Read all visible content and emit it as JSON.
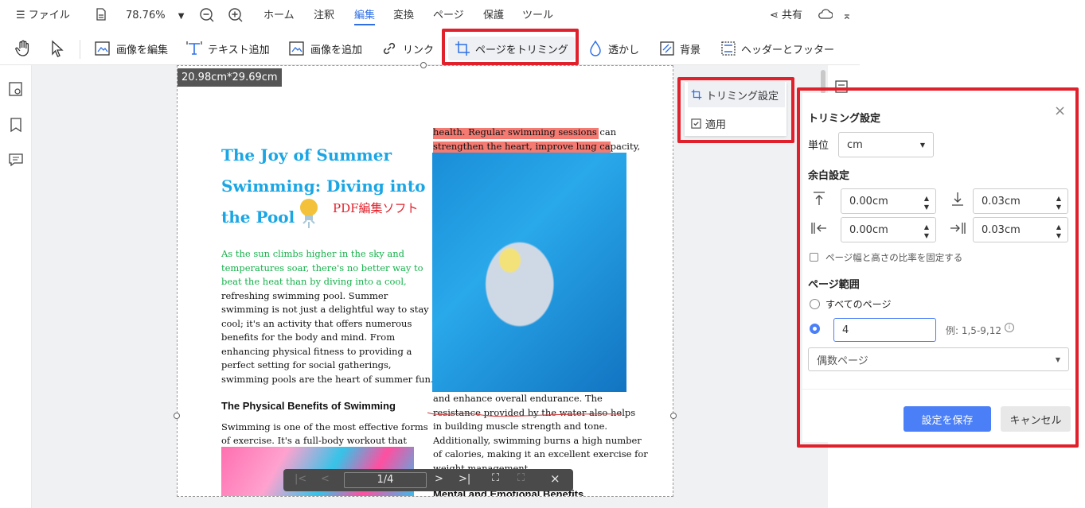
{
  "menubar": {
    "file_label": "ファイル",
    "zoom": "78.76%",
    "tabs": [
      "ホーム",
      "注釈",
      "編集",
      "変換",
      "ページ",
      "保護",
      "ツール"
    ],
    "active_tab": "編集",
    "share_label": "共有"
  },
  "toolbar": {
    "edit_image": "画像を編集",
    "add_text": "テキスト追加",
    "add_image": "画像を追加",
    "link": "リンク",
    "crop_page": "ページをトリミング",
    "watermark": "透かし",
    "background": "背景",
    "header_footer": "ヘッダーとフッター"
  },
  "document": {
    "dimension": "20.98cm*29.69cm",
    "title_lines": [
      "The Joy of Summer",
      "Swimming: Diving into",
      "the Pool"
    ],
    "annotation": "PDF編集ソフト",
    "intro_green": [
      "As the sun climbs higher in the sky and",
      "temperatures soar, there's no better way to",
      "beat the heat than by diving into a cool,"
    ],
    "intro_black": [
      "refreshing swimming pool. Summer",
      "swimming is not just a delightful way to stay",
      "cool; it's an activity that offers numerous",
      "benefits for the body and mind. From",
      "enhancing physical fitness to providing a",
      "perfect setting for social gatherings,",
      "swimming pools are the heart of summer fun."
    ],
    "subheading": "The Physical Benefits of Swimming",
    "body_left": [
      "Swimming is one of the most effective forms",
      "of exercise. It's a full-body workout that"
    ],
    "right_top": [
      "health. Regular swimming sessions can",
      "strengthen the heart, improve lung capacity,"
    ],
    "right_bottom": [
      "and enhance overall endurance. The",
      "resistance provided by the water also helps",
      "in building muscle strength and tone.",
      "Additionally, swimming burns a high number",
      "of calories, making it an excellent exercise for",
      "weight management."
    ],
    "right_heading": "Mental and Emotional Benefits"
  },
  "crop_menu": {
    "settings": "トリミング設定",
    "apply": "適用"
  },
  "panel": {
    "title": "トリミング設定",
    "unit_label": "単位",
    "unit_value": "cm",
    "margin_label": "余白設定",
    "top": "0.00cm",
    "bottom": "0.03cm",
    "left": "0.00cm",
    "right": "0.03cm",
    "ratio_label": "ページ幅と高さの比率を固定する",
    "range_label": "ページ範囲",
    "all_pages": "すべてのページ",
    "page_input": "4",
    "example": "例: 1,5-9,12",
    "subset": "偶数ページ",
    "save": "設定を保存",
    "cancel": "キャンセル"
  },
  "nav": {
    "page": "1/4"
  },
  "colors": {
    "accent": "#4a7ff7",
    "highlight_frame": "#e0202a",
    "title": "#1aa6e4",
    "green_text": "#14b14a"
  }
}
